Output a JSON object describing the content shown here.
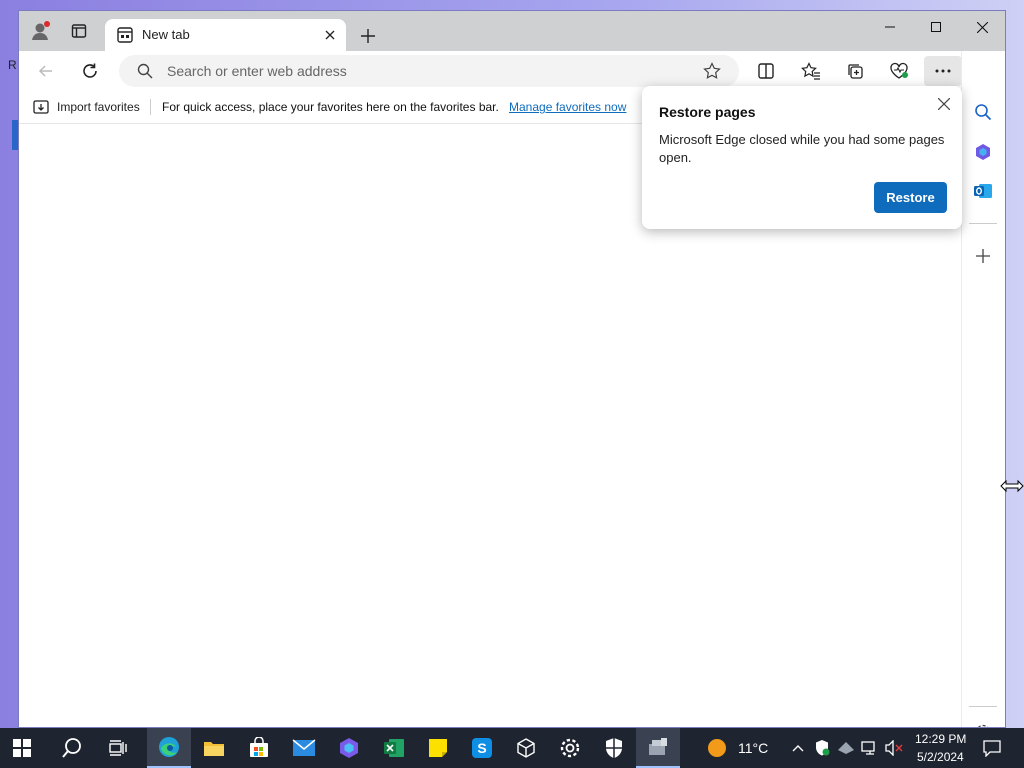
{
  "browser": {
    "tab": {
      "title": "New tab",
      "close_icon": "close-icon"
    },
    "window_controls": [
      "minimize",
      "maximize",
      "close"
    ],
    "address_bar": {
      "placeholder": "Search or enter web address"
    },
    "favorites_bar": {
      "import_label": "Import favorites",
      "message": "For quick access, place your favorites here on the favorites bar.",
      "manage_link": "Manage favorites now"
    },
    "sidebar_icons": [
      "search-icon",
      "copilot-app-icon",
      "outlook-icon",
      "add-icon",
      "settings-icon"
    ]
  },
  "restore_popup": {
    "title": "Restore pages",
    "body": "Microsoft Edge closed while you had some pages open.",
    "button": "Restore"
  },
  "taskbar": {
    "apps": [
      "start",
      "search",
      "task-view",
      "edge",
      "file-explorer",
      "store",
      "mail",
      "copilot",
      "excel",
      "sticky-notes",
      "skype",
      "3d-viewer",
      "settings",
      "security",
      "app"
    ],
    "weather": {
      "temp": "11°C"
    },
    "clock": {
      "time": "12:29 PM",
      "date": "5/2/2024"
    }
  },
  "colors": {
    "accent": "#0f6cbd",
    "taskbar": "#1f2530",
    "titlebar": "#cfd0d2"
  }
}
